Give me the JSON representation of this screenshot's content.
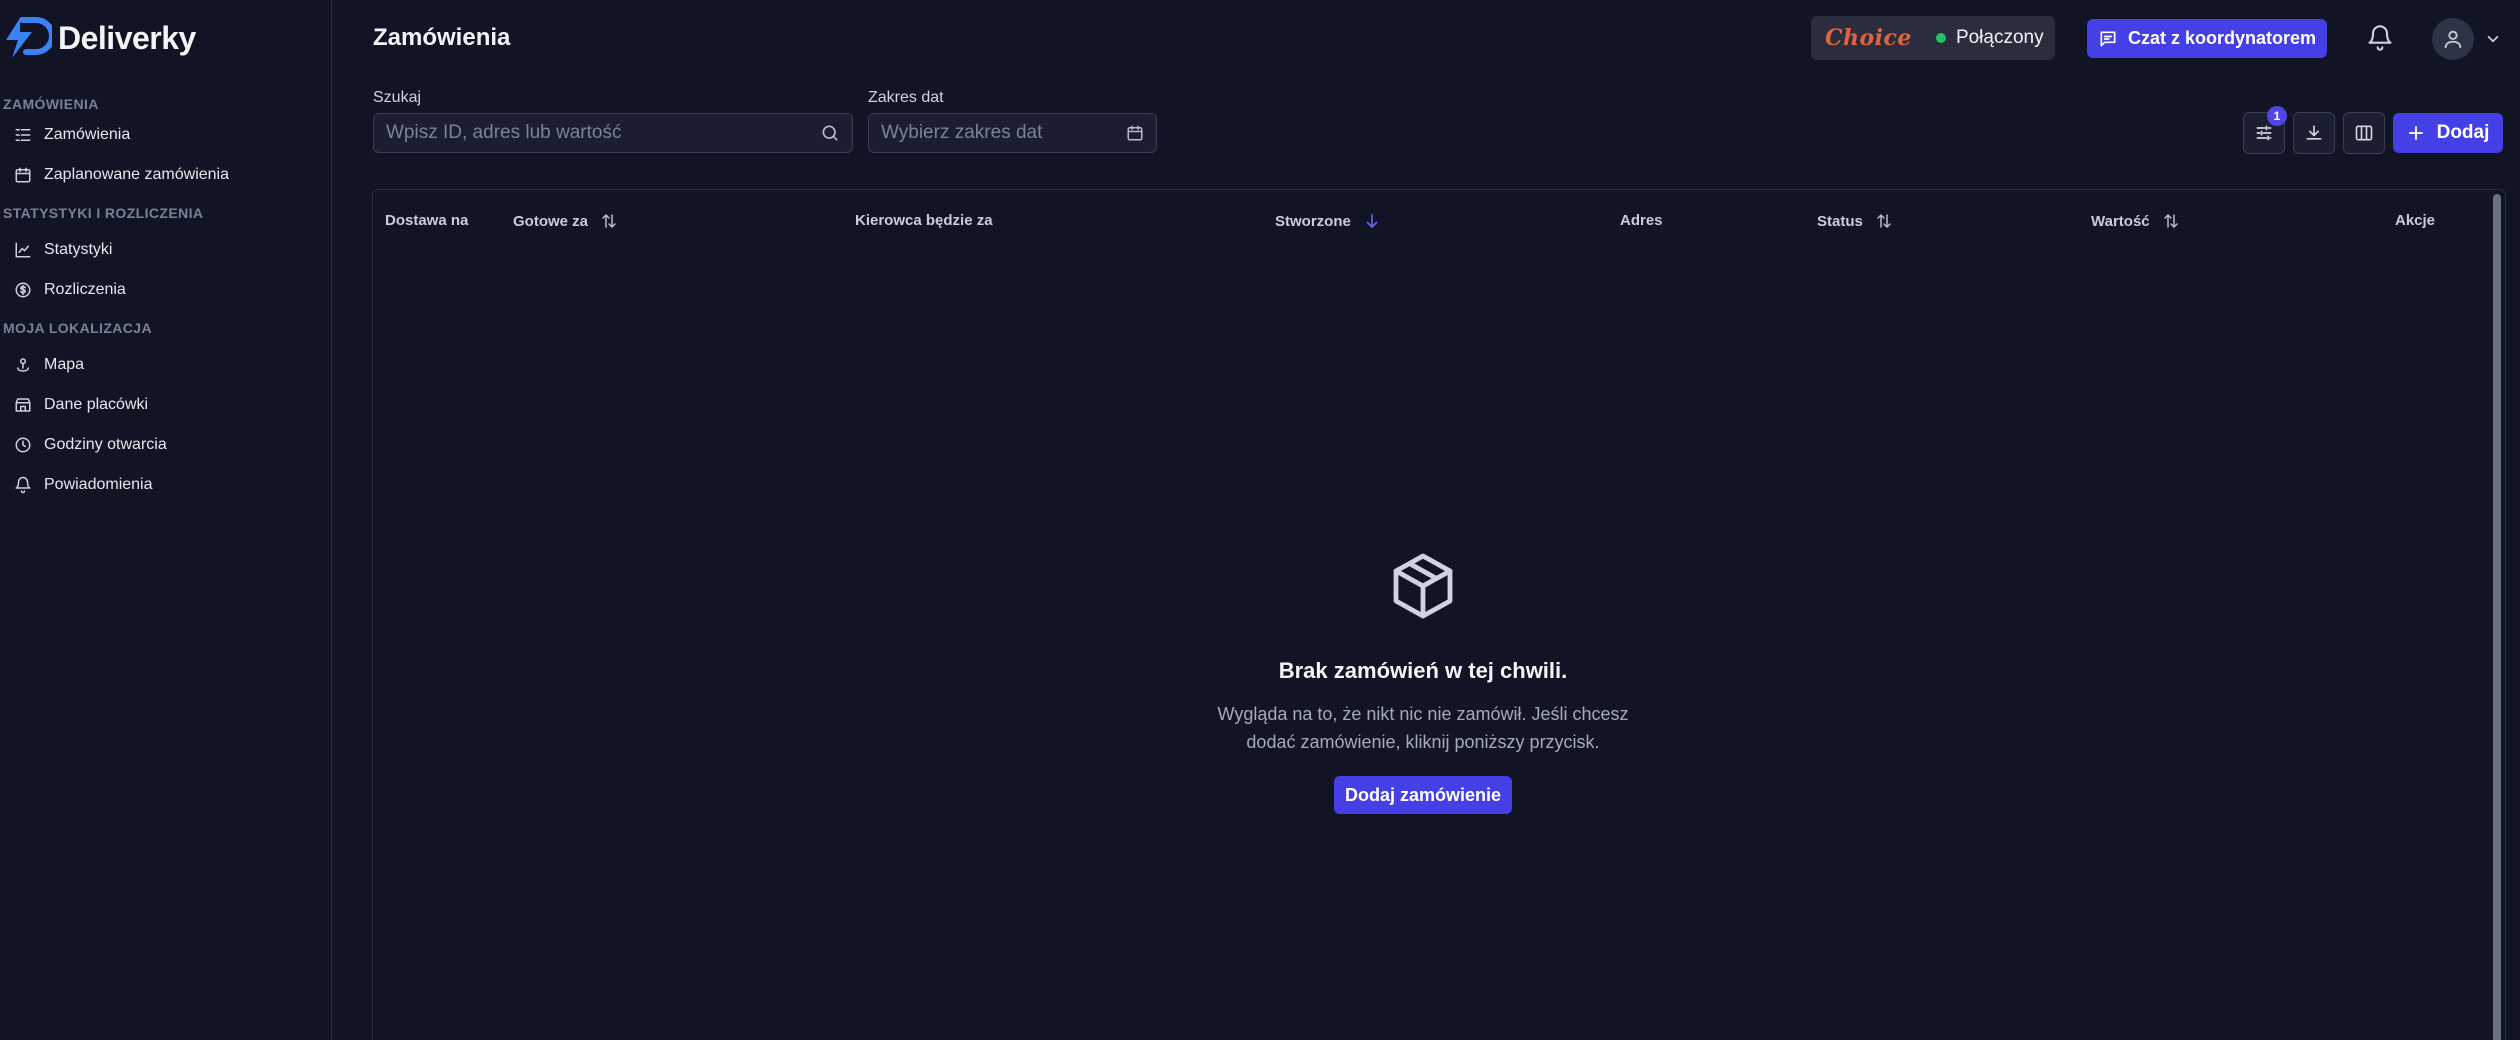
{
  "brand": {
    "name": "Deliverky"
  },
  "sidebar": {
    "sections": [
      {
        "title": "ZAMÓWIENIA"
      },
      {
        "title": "STATYSTYKI I ROZLICZENIA"
      },
      {
        "title": "MOJA LOKALIZACJA"
      }
    ],
    "items": [
      {
        "label": "Zamówienia",
        "icon": "orders-icon"
      },
      {
        "label": "Zaplanowane zamówienia",
        "icon": "calendar-icon"
      },
      {
        "label": "Statystyki",
        "icon": "chart-icon"
      },
      {
        "label": "Rozliczenia",
        "icon": "dollar-icon"
      },
      {
        "label": "Mapa",
        "icon": "map-pin-icon"
      },
      {
        "label": "Dane placówki",
        "icon": "store-icon"
      },
      {
        "label": "Godziny otwarcia",
        "icon": "clock-icon"
      },
      {
        "label": "Powiadomienia",
        "icon": "bell-icon"
      }
    ]
  },
  "header": {
    "title": "Zamówienia",
    "partner_logo": "Choice",
    "connection_status": "Połączony",
    "chat_button": "Czat z koordynatorem"
  },
  "filters": {
    "search_label": "Szukaj",
    "search_placeholder": "Wpisz ID, adres lub wartość",
    "date_label": "Zakres dat",
    "date_placeholder": "Wybierz zakres dat",
    "active_filters_count": "1",
    "add_button": "Dodaj"
  },
  "table": {
    "columns": [
      {
        "label": "Dostawa na",
        "sort": "none"
      },
      {
        "label": "Gotowe za",
        "sort": "sortable"
      },
      {
        "label": "Kierowca będzie za",
        "sort": "none"
      },
      {
        "label": "Stworzone",
        "sort": "desc"
      },
      {
        "label": "Adres",
        "sort": "none"
      },
      {
        "label": "Status",
        "sort": "sortable"
      },
      {
        "label": "Wartość",
        "sort": "sortable"
      },
      {
        "label": "Akcje",
        "sort": "none"
      }
    ],
    "rows": []
  },
  "empty_state": {
    "title": "Brak zamówień w tej chwili.",
    "description_line1": "Wygląda na to, że nikt nic nie zamówił. Jeśli chcesz",
    "description_line2": "dodać zamówienie, kliknij poniższy przycisk.",
    "button": "Dodaj zamówienie"
  },
  "colors": {
    "background": "#111425",
    "accent": "#4540e6",
    "status_online": "#22c55e",
    "partner_brand": "#e3643a"
  }
}
